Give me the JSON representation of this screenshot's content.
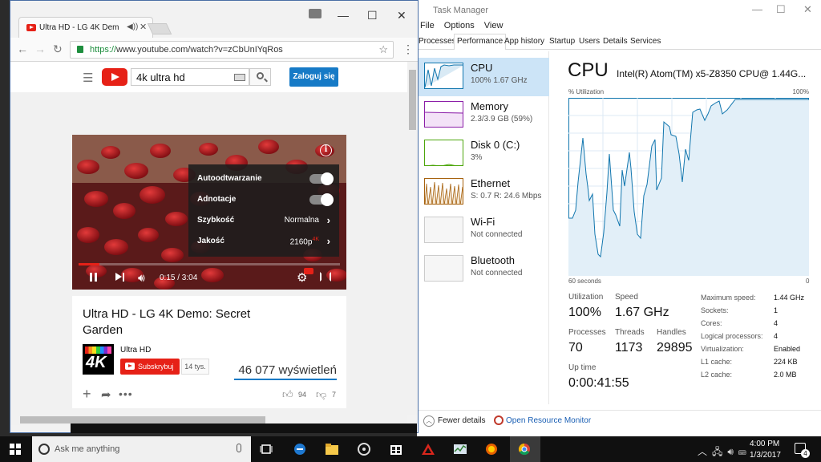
{
  "task_manager": {
    "title": "Task Manager",
    "menu": [
      "File",
      "Options",
      "View"
    ],
    "tabs": [
      "Processes",
      "Performance",
      "App history",
      "Startup",
      "Users",
      "Details",
      "Services"
    ],
    "active_tab": "Performance",
    "resources": [
      {
        "name": "CPU",
        "sub": "100%  1.67 GHz",
        "color": "#1176ae"
      },
      {
        "name": "Memory",
        "sub": "2.3/3.9 GB (59%)",
        "color": "#8b1ea8"
      },
      {
        "name": "Disk 0 (C:)",
        "sub": "3%",
        "color": "#4da60c"
      },
      {
        "name": "Ethernet",
        "sub": "S: 0.7  R: 24.6 Mbps",
        "color": "#a7620f"
      },
      {
        "name": "Wi-Fi",
        "sub": "Not connected",
        "color": "#a7620f"
      },
      {
        "name": "Bluetooth",
        "sub": "Not connected",
        "color": "#a7620f"
      }
    ],
    "cpu": {
      "heading": "CPU",
      "model": "Intel(R) Atom(TM) x5-Z8350 CPU@ 1.44G...",
      "util_label": "% Utilization",
      "util_max": "100%",
      "graph_left": "60 seconds",
      "graph_right": "0",
      "utilization_label": "Utilization",
      "utilization": "100%",
      "speed_label": "Speed",
      "speed": "1.67 GHz",
      "processes_label": "Processes",
      "processes": "70",
      "threads_label": "Threads",
      "threads": "1173",
      "handles_label": "Handles",
      "handles": "29895",
      "uptime_label": "Up time",
      "uptime": "0:00:41:55",
      "details": [
        {
          "k": "Maximum speed:",
          "v": "1.44 GHz"
        },
        {
          "k": "Sockets:",
          "v": "1"
        },
        {
          "k": "Cores:",
          "v": "4"
        },
        {
          "k": "Logical processors:",
          "v": "4"
        },
        {
          "k": "Virtualization:",
          "v": "Enabled"
        },
        {
          "k": "L1 cache:",
          "v": "224 KB"
        },
        {
          "k": "L2 cache:",
          "v": "2.0 MB"
        }
      ]
    },
    "footer": {
      "fewer": "Fewer details",
      "resource_monitor": "Open Resource Monitor"
    }
  },
  "chrome": {
    "tab_title": "Ultra HD - LG 4K Dem",
    "tab_audio": "◀))",
    "url_scheme": "https://",
    "url_rest": "www.youtube.com/watch?v=zCbUnIYqRos"
  },
  "youtube": {
    "search_value": "4k ultra hd",
    "login_label": "Zaloguj się",
    "settings": [
      {
        "label": "Autoodtwarzanie",
        "value": "",
        "type": "toggle"
      },
      {
        "label": "Adnotacje",
        "value": "",
        "type": "toggle"
      },
      {
        "label": "Szybkość",
        "value": "Normalna",
        "type": "menu"
      },
      {
        "label": "Jakość",
        "value": "2160p",
        "badge": "4K",
        "type": "menu"
      }
    ],
    "time": "0:15 / 3:04",
    "progress_fraction": 0.08,
    "video_title": "Ultra HD - LG 4K Demo: Secret Garden",
    "channel_name": "Ultra HD",
    "channel_logo_text": "4K",
    "subscribe_label": "Subskrybuj",
    "subscriber_count": "14 tys.",
    "views": "46 077 wyświetleń",
    "likes": "94",
    "dislikes": "7"
  },
  "taskbar": {
    "search_placeholder": "Ask me anything",
    "time": "4:00 PM",
    "date": "1/3/2017",
    "notifications": "4"
  }
}
